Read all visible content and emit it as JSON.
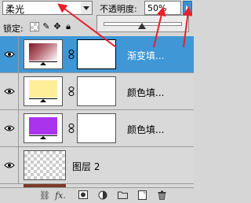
{
  "toolbar": {
    "blend_mode": "柔光",
    "opacity_label": "不透明度:",
    "opacity_value": "50%",
    "opacity_slider_level": 0.5
  },
  "lock": {
    "label": "锁定:"
  },
  "layers": [
    {
      "name": "渐变填...",
      "kind": "gradient-fill",
      "selected": true
    },
    {
      "name": "颜色填...",
      "kind": "color-fill",
      "color": "#ffee99",
      "selected": false
    },
    {
      "name": "颜色填...",
      "kind": "color-fill",
      "color": "#aa33ee",
      "selected": false
    },
    {
      "name": "图层 2",
      "kind": "pixel",
      "selected": false
    }
  ],
  "colors": {
    "selection": "#3f97d6",
    "annotation": "#e8202a"
  },
  "icons": {
    "eye": "eye-icon",
    "link": "link-icon",
    "fx": "fx-icon",
    "mask": "add-mask-icon",
    "adjust": "adjustment-layer-icon",
    "folder": "new-group-icon",
    "new": "new-layer-icon",
    "trash": "delete-layer-icon"
  }
}
